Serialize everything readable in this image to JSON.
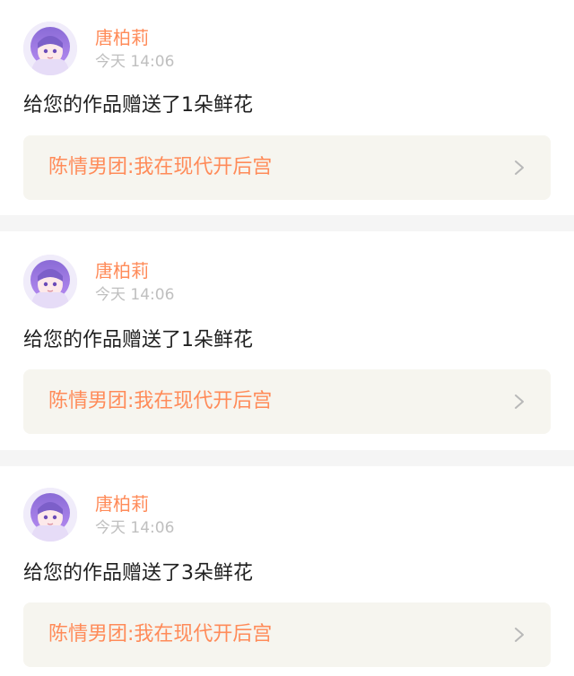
{
  "items": [
    {
      "username": "唐柏莉",
      "time": "今天 14:06",
      "message": "给您的作品赠送了1朵鲜花",
      "work_title": "陈情男团:我在现代开后宫"
    },
    {
      "username": "唐柏莉",
      "time": "今天 14:06",
      "message": "给您的作品赠送了1朵鲜花",
      "work_title": "陈情男团:我在现代开后宫"
    },
    {
      "username": "唐柏莉",
      "time": "今天 14:06",
      "message": "给您的作品赠送了3朵鲜花",
      "work_title": "陈情男团:我在现代开后宫"
    }
  ],
  "colors": {
    "accent": "#ff8b59",
    "time": "#bfbfbf",
    "text": "#1f1f1f",
    "work_box_bg": "#f6f5ef",
    "separator": "#f5f5f5"
  },
  "icons": {
    "avatar": "anime-girl-avatar",
    "chevron": "chevron-right-icon"
  }
}
